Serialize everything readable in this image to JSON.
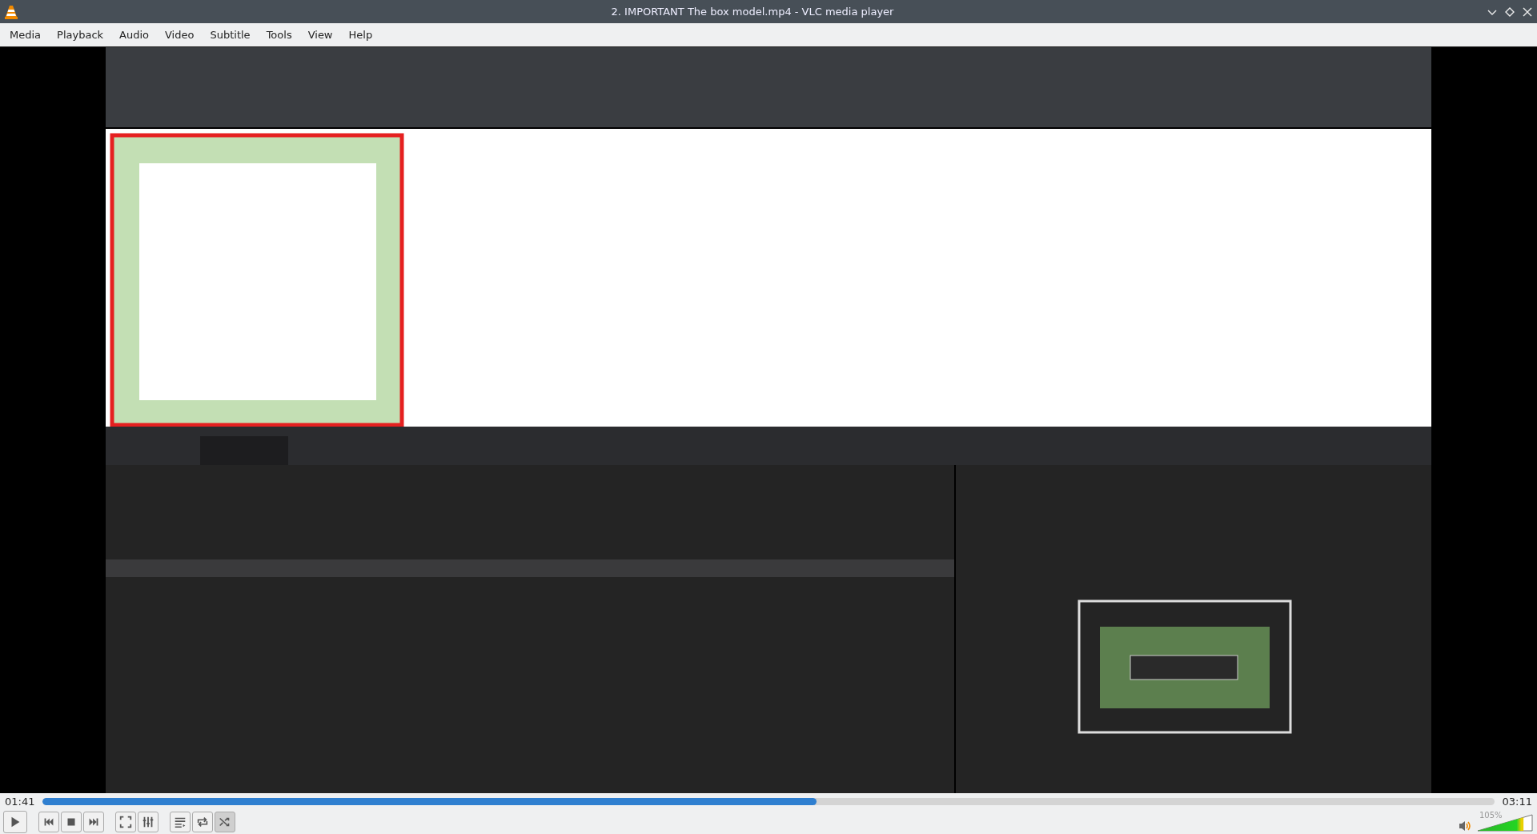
{
  "window": {
    "title": "2. IMPORTANT The box model.mp4 - VLC media player"
  },
  "menu": [
    "Media",
    "Playback",
    "Audio",
    "Video",
    "Subtitle",
    "Tools",
    "View",
    "Help"
  ],
  "video": {
    "kind": "picture"
  },
  "timeline": {
    "elapsed": "01:41",
    "total": "03:11",
    "level": 0.533
  },
  "controls": [
    {
      "kind": "play"
    },
    {
      "kind": "previous"
    },
    {
      "kind": "stop"
    },
    {
      "kind": "next"
    },
    {
      "kind": "fullscreen"
    },
    {
      "kind": "extended"
    },
    {
      "kind": "playlist"
    },
    {
      "kind": "loop",
      "selected": false
    },
    {
      "kind": "shuffle",
      "selected": true
    }
  ],
  "volume": {
    "reading": "105%",
    "level": 0.84
  }
}
